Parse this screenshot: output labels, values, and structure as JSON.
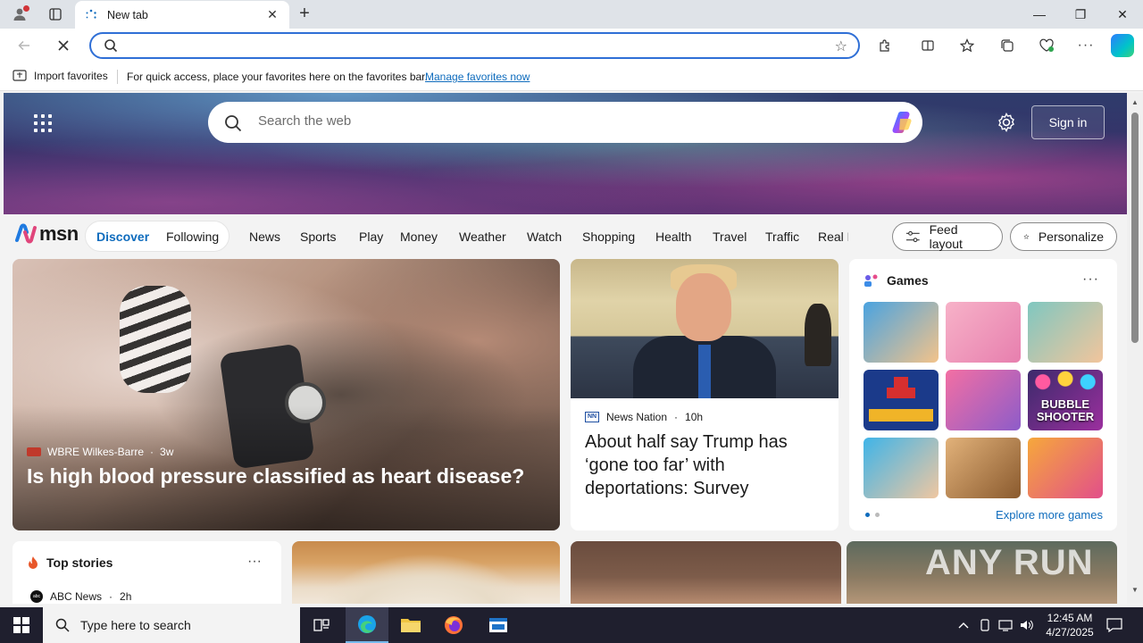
{
  "browser": {
    "tab_title": "New tab",
    "address_value": "",
    "favorites_bar": {
      "import_label": "Import favorites",
      "message": "For quick access, place your favorites here on the favorites bar.",
      "manage_link": "Manage favorites now"
    }
  },
  "msn": {
    "search_placeholder": "Search the web",
    "sign_in": "Sign in",
    "logo_text": "msn",
    "pill_tabs": [
      "Discover",
      "Following"
    ],
    "nav_items": [
      "News",
      "Sports",
      "Play",
      "Money",
      "Weather",
      "Watch",
      "Shopping",
      "Health",
      "Travel",
      "Traffic",
      "Real E"
    ],
    "feed_layout": "Feed layout",
    "personalize": "Personalize"
  },
  "hero_story": {
    "source": "WBRE Wilkes-Barre",
    "age": "3w",
    "title": "Is high blood pressure classified as heart disease?"
  },
  "news_story": {
    "source": "News Nation",
    "age": "10h",
    "title": "About half say Trump has ‘gone too far’ with deportations: Survey"
  },
  "games": {
    "heading": "Games",
    "tiles": [
      {
        "colors": [
          "#4aa3e0",
          "#f3c38a"
        ]
      },
      {
        "colors": [
          "#f7b2c8",
          "#e77fae"
        ]
      },
      {
        "colors": [
          "#7fc7c0",
          "#f2c59c"
        ]
      },
      {
        "colors": [
          "#1b3a8a",
          "#d62f2f"
        ]
      },
      {
        "colors": [
          "#f36fa3",
          "#8d5cc9"
        ]
      },
      {
        "colors": [
          "#3b2a6b",
          "#9b2f9e"
        ],
        "label": "BUBBLE SHOOTER"
      },
      {
        "colors": [
          "#3fb4e8",
          "#f0c7a1"
        ]
      },
      {
        "colors": [
          "#c98f52",
          "#8a5a2e"
        ]
      },
      {
        "colors": [
          "#f6a83b",
          "#e24f8a"
        ]
      }
    ],
    "explore_link": "Explore more games"
  },
  "top_stories": {
    "heading": "Top stories",
    "source": "ABC News",
    "age": "2h"
  },
  "watermark": "ANY RUN",
  "taskbar": {
    "search_placeholder": "Type here to search",
    "time": "12:45 AM",
    "date": "4/27/2025"
  }
}
